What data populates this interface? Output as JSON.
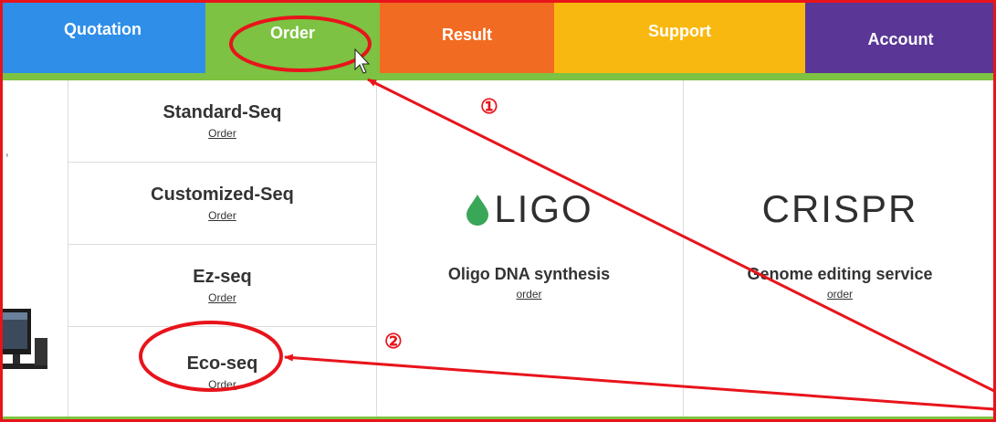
{
  "nav": {
    "tabs": [
      {
        "label": "Quotation",
        "color": "#2e8ee8"
      },
      {
        "label": "Order",
        "color": "#7dc242"
      },
      {
        "label": "Result",
        "color": "#f26b22"
      },
      {
        "label": "Support",
        "color": "#f9b80f"
      },
      {
        "label": "Account",
        "color": "#5a3697"
      }
    ]
  },
  "menu": {
    "items": [
      {
        "title": "Standard-Seq",
        "link": "Order"
      },
      {
        "title": "Customized-Seq",
        "link": "Order"
      },
      {
        "title": "Ez-seq",
        "link": "Order"
      },
      {
        "title": "Eco-seq",
        "link": "Order"
      }
    ]
  },
  "services": {
    "oligo": {
      "logo_text": "LIGO",
      "name": "Oligo DNA synthesis",
      "link": "order",
      "leaf_color": "#3aa657"
    },
    "crispr": {
      "logo_text": "CRISPR",
      "name": "Genome editing service",
      "link": "order"
    }
  },
  "annotations": {
    "step1": "①",
    "step2": "②",
    "color": "#e8141b"
  },
  "page": {
    "stray_char": ","
  }
}
